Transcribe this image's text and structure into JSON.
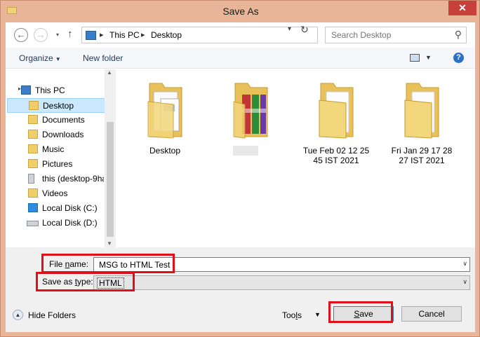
{
  "window": {
    "title": "Save As",
    "close_glyph": "✕"
  },
  "nav": {
    "back_glyph": "←",
    "forward_glyph": "→",
    "up_glyph": "↑",
    "recent_glyph": "▾",
    "address": [
      "This PC",
      "Desktop"
    ],
    "address_sep": "▸",
    "refresh_glyph": "↻",
    "dropdown_glyph": "▾"
  },
  "search": {
    "placeholder": "Search Desktop",
    "icon_glyph": "⚲"
  },
  "toolbar": {
    "organize": "Organize",
    "new_folder": "New folder",
    "help_glyph": "?",
    "dropdown_glyph": "▼"
  },
  "sidebar": {
    "items": [
      {
        "label": "This PC",
        "icon": "pc-icon"
      },
      {
        "label": "Desktop",
        "icon": "folder-icon",
        "selected": true
      },
      {
        "label": "Documents",
        "icon": "folder-icon"
      },
      {
        "label": "Downloads",
        "icon": "folder-icon"
      },
      {
        "label": "Music",
        "icon": "folder-icon"
      },
      {
        "label": "Pictures",
        "icon": "folder-icon"
      },
      {
        "label": "this (desktop-9ha",
        "icon": "network-drive-icon"
      },
      {
        "label": "Videos",
        "icon": "folder-icon"
      },
      {
        "label": "Local Disk (C:)",
        "icon": "windows-drive-icon"
      },
      {
        "label": "Local Disk (D:)",
        "icon": "drive-icon"
      }
    ],
    "expander_glyph": "▸",
    "scroll_up_glyph": "▲",
    "scroll_down_glyph": "▼"
  },
  "files": [
    {
      "name": "Desktop",
      "type": "folder-with-documents"
    },
    {
      "name": "",
      "type": "folder-with-books"
    },
    {
      "name": "Tue Feb 02 12 25 45 IST 2021",
      "type": "folder"
    },
    {
      "name": "Fri Jan 29 17 28 27 IST 2021",
      "type": "folder"
    }
  ],
  "form": {
    "file_name_label_pre": "File ",
    "file_name_label_u": "n",
    "file_name_label_post": "ame:",
    "file_name_value": "MSG to HTML Test",
    "save_type_label_pre": "Save as ",
    "save_type_label_u": "t",
    "save_type_label_post": "ype:",
    "save_type_value": "HTML",
    "dropdown_glyph": "∨"
  },
  "footer": {
    "hide_folders": "Hide Folders",
    "hide_glyph": "▲",
    "tools_pre": "Too",
    "tools_u": "l",
    "tools_post": "s",
    "tools_dd": "▼",
    "save_u": "S",
    "save_post": "ave",
    "cancel": "Cancel"
  },
  "colors": {
    "highlight": "#e0101a",
    "frame": "#e9b598",
    "selection": "#cce8ff"
  }
}
